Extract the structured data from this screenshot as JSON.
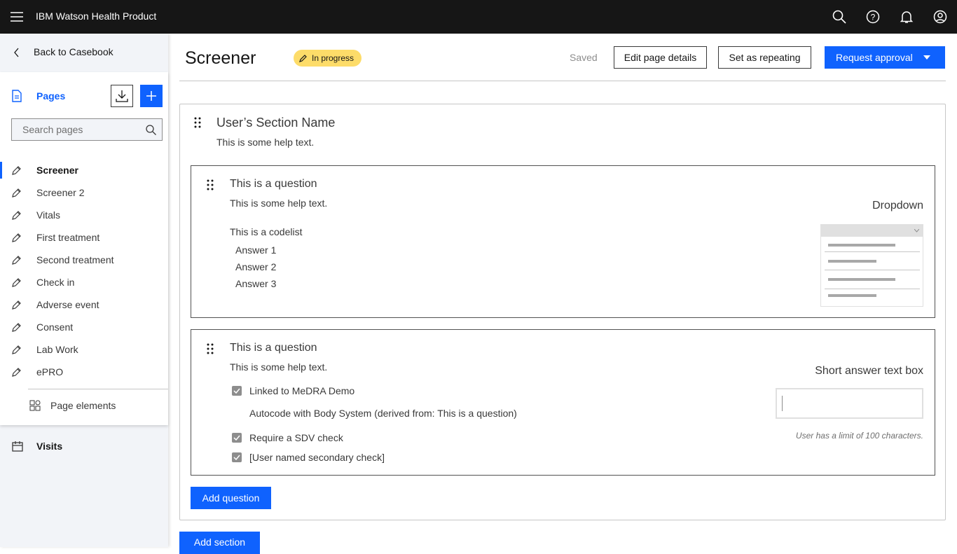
{
  "header": {
    "title": "IBM Watson Health Product"
  },
  "sidebar": {
    "back": "Back to Casebook",
    "pages_label": "Pages",
    "search_placeholder": "Search pages",
    "items": [
      {
        "label": "Screener",
        "selected": true
      },
      {
        "label": "Screener 2"
      },
      {
        "label": "Vitals"
      },
      {
        "label": "First treatment"
      },
      {
        "label": "Second treatment"
      },
      {
        "label": "Check in"
      },
      {
        "label": "Adverse event"
      },
      {
        "label": "Consent"
      },
      {
        "label": "Lab Work"
      },
      {
        "label": "ePRO"
      }
    ],
    "page_elements": "Page elements",
    "visits": "Visits"
  },
  "page": {
    "title": "Screener",
    "status": "In progress",
    "saved": "Saved",
    "edit": "Edit page details",
    "repeating": "Set as repeating",
    "approval": "Request approval"
  },
  "section": {
    "name": "User’s Section Name",
    "help": "This is some help text.",
    "q1": {
      "title": "This is a question",
      "help": "This is some help text.",
      "codelist": "This is a codelist",
      "answers": [
        "Answer 1",
        "Answer 2",
        "Answer 3"
      ],
      "type": "Dropdown"
    },
    "q2": {
      "title": "This is a question",
      "help": "This is some help text.",
      "checks": [
        "Linked to MeDRA Demo",
        "Require a SDV check",
        "[User named secondary check]"
      ],
      "autocode": "Autocode with Body System (derived from: This is a question)",
      "type": "Short answer text box",
      "limit": "User has a limit of 100 characters."
    },
    "add_question": "Add question"
  },
  "add_section": "Add section",
  "colors": {
    "primary": "#0f62fe",
    "badge": "#fddc69"
  }
}
